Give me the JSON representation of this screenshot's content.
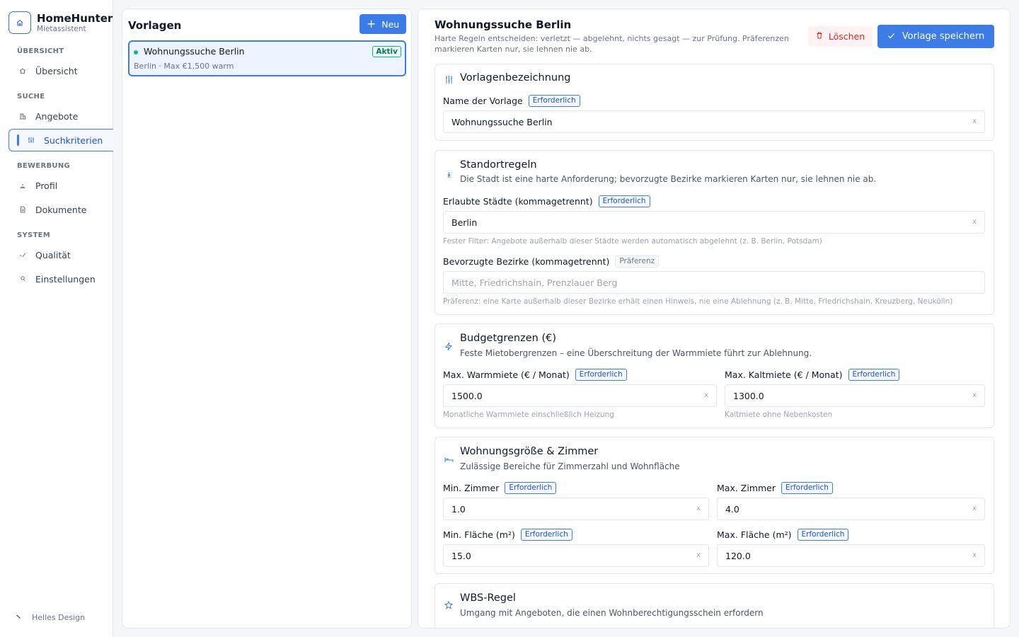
{
  "brand": {
    "name": "HomeHunter",
    "subtitle": "Mietassistent"
  },
  "sidebar": {
    "sections": [
      {
        "label": "ÜBERSICHT"
      },
      {
        "label": "SUCHE"
      },
      {
        "label": "BEWERBUNG"
      },
      {
        "label": "SYSTEM"
      }
    ],
    "items": [
      {
        "label": "Übersicht",
        "icon": "home-icon"
      },
      {
        "label": "Angebote",
        "icon": "building-icon"
      },
      {
        "label": "Suchkriterien",
        "icon": "sliders-icon",
        "active": true
      },
      {
        "label": "Profil",
        "icon": "user-icon"
      },
      {
        "label": "Dokumente",
        "icon": "file-icon"
      },
      {
        "label": "Qualität",
        "icon": "check-icon"
      },
      {
        "label": "Einstellungen",
        "icon": "settings-icon"
      }
    ],
    "theme_toggle": "Helles Design"
  },
  "templates": {
    "title": "Vorlagen",
    "new_label": "Neu",
    "items": [
      {
        "name": "Wohnungssuche Berlin",
        "meta": "Berlin · Max €1,500 warm",
        "badge": "Aktiv"
      }
    ]
  },
  "editor": {
    "title": "Wohnungssuche Berlin",
    "description": "Harte Regeln entscheiden: verletzt — abgelehnt, nichts gesagt — zur Prüfung. Präferenzen markieren Karten nur, sie lehnen nie ab.",
    "delete_label": "Löschen",
    "save_label": "Vorlage speichern",
    "required_badge": "Erforderlich",
    "preference_badge": "Präferenz",
    "clear_glyph": "x",
    "sections": {
      "name": {
        "title": "Vorlagenbezeichnung",
        "field_label": "Name der Vorlage",
        "value": "Wohnungssuche Berlin"
      },
      "location": {
        "title": "Standortregeln",
        "subtitle": "Die Stadt ist eine harte Anforderung; bevorzugte Bezirke markieren Karten nur, sie lehnen nie ab.",
        "cities_label": "Erlaubte Städte (kommagetrennt)",
        "cities_value": "Berlin",
        "cities_help": "Fester Filter: Angebote außerhalb dieser Städte werden automatisch abgelehnt (z. B. Berlin, Potsdam)",
        "districts_label": "Bevorzugte Bezirke (kommagetrennt)",
        "districts_placeholder": "Mitte, Friedrichshain, Prenzlauer Berg",
        "districts_help": "Präferenz: eine Karte außerhalb dieser Bezirke erhält einen Hinweis, nie eine Ablehnung (z. B. Mitte, Friedrichshain, Kreuzberg, Neukölln)"
      },
      "budget": {
        "title": "Budgetgrenzen (€)",
        "subtitle": "Feste Mietobergrenzen – eine Überschreitung der Warmmiete führt zur Ablehnung.",
        "warm_label": "Max. Warmmiete (€ / Monat)",
        "warm_value": "1500.0",
        "warm_help": "Monatliche Warmmiete einschließlich Heizung",
        "cold_label": "Max. Kaltmiete (€ / Monat)",
        "cold_value": "1300.0",
        "cold_help": "Kaltmiete ohne Nebenkosten"
      },
      "size": {
        "title": "Wohnungsgröße & Zimmer",
        "subtitle": "Zulässige Bereiche für Zimmerzahl und Wohnfläche",
        "min_rooms_label": "Min. Zimmer",
        "min_rooms_value": "1.0",
        "max_rooms_label": "Max. Zimmer",
        "max_rooms_value": "4.0",
        "min_area_label": "Min. Fläche (m²)",
        "min_area_value": "15.0",
        "max_area_label": "Max. Fläche (m²)",
        "max_area_value": "120.0"
      },
      "wbs": {
        "title": "WBS-Regel",
        "subtitle": "Umgang mit Angeboten, die einen Wohnberechtigungsschein erfordern"
      }
    }
  },
  "colors": {
    "accent": "#3b7ce8",
    "danger": "#dc2626",
    "success": "#10b981"
  }
}
